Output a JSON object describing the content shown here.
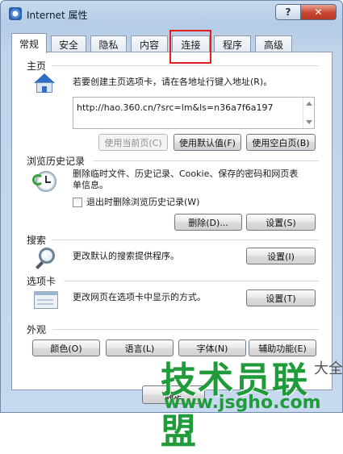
{
  "window": {
    "title": "Internet 属性",
    "help": "?",
    "close": "✕"
  },
  "tabs": [
    {
      "label": "常规",
      "active": true
    },
    {
      "label": "安全"
    },
    {
      "label": "隐私"
    },
    {
      "label": "内容"
    },
    {
      "label": "连接",
      "highlighted": true
    },
    {
      "label": "程序"
    },
    {
      "label": "高级"
    }
  ],
  "home": {
    "group_label": "主页",
    "description": "若要创建主页选项卡，请在各地址行键入地址(R)。",
    "url": "http://hao.360.cn/?src=lm&ls=n36a7f6a197",
    "buttons": {
      "use_current": "使用当前页(C)",
      "use_default": "使用默认值(F)",
      "use_blank": "使用空白页(B)"
    }
  },
  "history": {
    "group_label": "浏览历史记录",
    "description": "删除临时文件、历史记录、Cookie、保存的密码和网页表单信息。",
    "checkbox_label": "退出时删除浏览历史记录(W)",
    "buttons": {
      "delete": "删除(D)...",
      "settings": "设置(S)"
    }
  },
  "search": {
    "group_label": "搜索",
    "description": "更改默认的搜索提供程序。",
    "settings": "设置(I)"
  },
  "tabs_section": {
    "group_label": "选项卡",
    "description": "更改网页在选项卡中显示的方式。",
    "settings": "设置(T)"
  },
  "appearance": {
    "group_label": "外观",
    "buttons": {
      "colors": "颜色(O)",
      "languages": "语言(L)",
      "fonts": "字体(N)",
      "accessibility": "辅助功能(E)"
    }
  },
  "footer": {
    "ok": "确定"
  },
  "watermark": {
    "main": "技术员联盟",
    "side": "大全",
    "url": "www.jsgho.com"
  },
  "colors": {
    "highlight": "#e01e1e",
    "watermark_green": "#1f9b3a"
  }
}
